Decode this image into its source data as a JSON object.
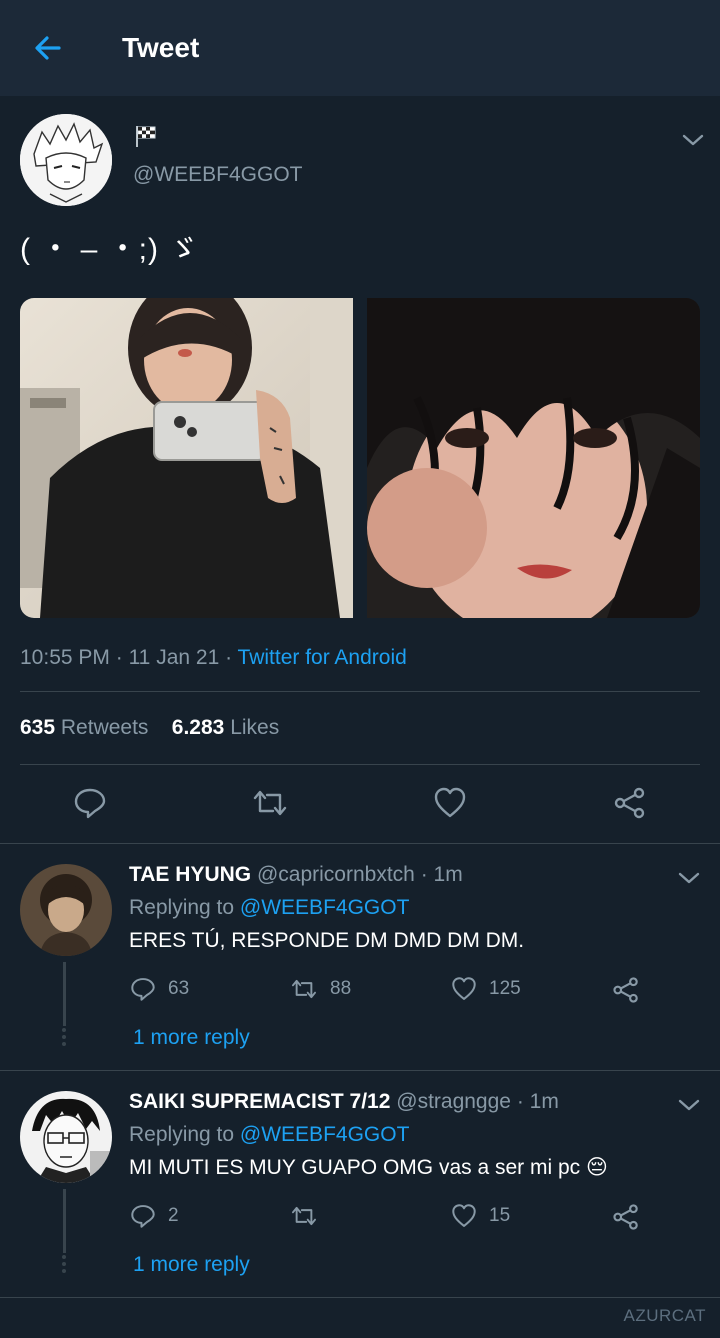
{
  "header": {
    "title": "Tweet"
  },
  "tweet": {
    "handle": "@WEEBF4GGOT",
    "text": "( ・ – ・;) ゞ",
    "time": "10:55 PM",
    "date": "11 Jan 21",
    "source": "Twitter for Android",
    "retweets": "635",
    "retweets_label": "Retweets",
    "likes": "6.283",
    "likes_label": "Likes"
  },
  "replies": [
    {
      "name": "TAE HYUNG",
      "handle": "@capricornbxtch",
      "time": "· 1m",
      "replying_label": "Replying to",
      "replying_to": "@WEEBF4GGOT",
      "text": "ERES TÚ, RESPONDE DM DMD DM DM.",
      "comments": "63",
      "retweets": "88",
      "likes": "125",
      "more": "1 more reply"
    },
    {
      "name": "SAIKI SUPREMACIST 7/12",
      "handle": "@stragngge",
      "time": "· 1m",
      "replying_label": "Replying to",
      "replying_to": "@WEEBF4GGOT",
      "text": "MI MUTI ES MUY GUAPO OMG vas a ser mi pc 😔",
      "comments": "2",
      "retweets": "",
      "likes": "15",
      "more": "1 more reply"
    }
  ],
  "watermark": "AZURCAT",
  "colors": {
    "background": "#15202b",
    "header": "#1c2938",
    "accent": "#1da1f2",
    "muted": "#8899a6",
    "divider": "#38444d"
  }
}
